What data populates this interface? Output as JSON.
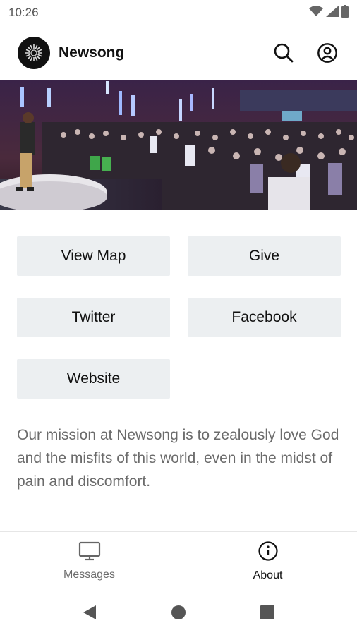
{
  "status_bar": {
    "time": "10:26",
    "icons": [
      "wifi-icon",
      "cell-signal-icon",
      "battery-icon"
    ]
  },
  "header": {
    "title": "Newsong",
    "logo_icon": "sunburst-logo",
    "actions": [
      "search-icon",
      "account-icon"
    ]
  },
  "hero": {
    "description_icon": "worship-photo"
  },
  "buttons": [
    {
      "label": "View Map"
    },
    {
      "label": "Give"
    },
    {
      "label": "Twitter"
    },
    {
      "label": "Facebook"
    },
    {
      "label": "Website"
    }
  ],
  "mission": "Our mission at Newsong is to zealously love God and the misfits of this world, even in the midst of pain and discomfort.",
  "bottom_nav": {
    "messages": {
      "label": "Messages",
      "icon": "tv-icon"
    },
    "about": {
      "label": "About",
      "icon": "info-icon"
    }
  },
  "system_nav": [
    "back-icon",
    "home-icon",
    "recents-icon"
  ],
  "colors": {
    "button_bg": "#eceff1",
    "text_primary": "#111111",
    "text_secondary": "#6b6b6b"
  }
}
